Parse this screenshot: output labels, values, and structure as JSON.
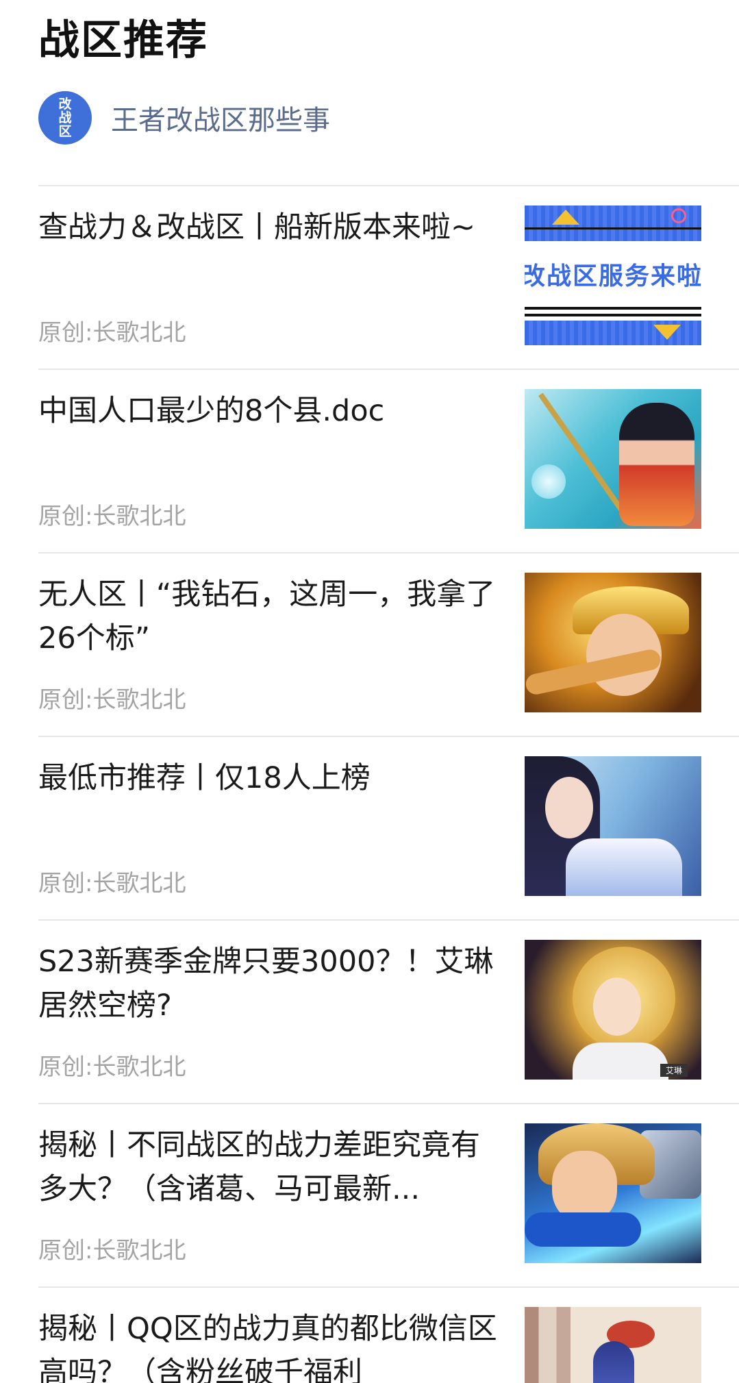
{
  "section": {
    "title": "战区推荐"
  },
  "account": {
    "avatar_lines": [
      "改",
      "战",
      "区"
    ],
    "name": "王者改战区那些事"
  },
  "articles": [
    {
      "title": "查战力＆改战区丨船新版本来啦~",
      "author": "原创:长歌北北",
      "thumb_text": "改战区服务来啦"
    },
    {
      "title": "中国人口最少的8个县.doc",
      "author": "原创:长歌北北"
    },
    {
      "title": "无人区丨“我钻石，这周一，我拿了26个标”",
      "author": "原创:长歌北北"
    },
    {
      "title": "最低市推荐丨仅18人上榜",
      "author": "原创:长歌北北"
    },
    {
      "title": "S23新赛季金牌只要3000？！艾琳居然空榜?",
      "author": "原创:长歌北北",
      "thumb_tag": "艾琳"
    },
    {
      "title": "揭秘丨不同战区的战力差距究竟有多大？（含诸葛、马可最新...",
      "author": "原创:长歌北北"
    },
    {
      "title": "揭秘丨QQ区的战力真的都比微信区高吗？（含粉丝破千福利",
      "author": ""
    }
  ]
}
